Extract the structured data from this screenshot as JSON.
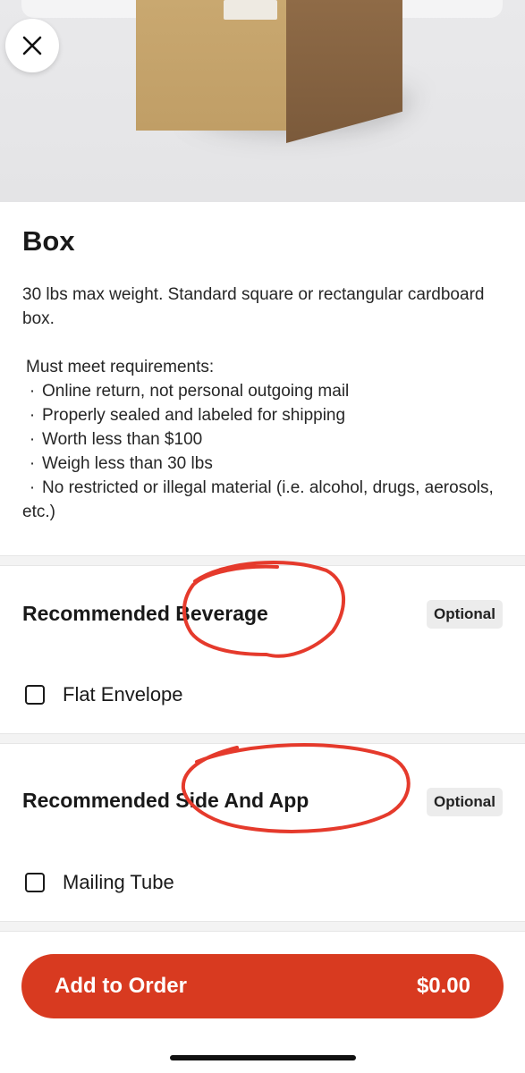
{
  "product": {
    "title": "Box",
    "description": "30 lbs max weight. Standard square or rectangular cardboard box.",
    "requirements_heading": "Must meet requirements:",
    "requirements": [
      "Online return, not personal outgoing mail",
      "Properly sealed and labeled for shipping",
      "Worth less than $100",
      "Weigh less than 30 lbs",
      "No restricted or illegal material (i.e. alcohol, drugs, aerosols, etc.)"
    ],
    "bullet_glyph": "·"
  },
  "sections": [
    {
      "title": "Recommended Beverage",
      "badge": "Optional",
      "options": [
        {
          "label": "Flat Envelope",
          "checked": false
        }
      ]
    },
    {
      "title": "Recommended Side And App",
      "badge": "Optional",
      "options": [
        {
          "label": "Mailing Tube",
          "checked": false
        }
      ]
    }
  ],
  "footer": {
    "button_label": "Add to Order",
    "price": "$0.00"
  },
  "colors": {
    "accent": "#d83a20",
    "annotation": "#e53a2c"
  },
  "icons": {
    "close": "close-icon",
    "checkbox": "checkbox-icon"
  }
}
